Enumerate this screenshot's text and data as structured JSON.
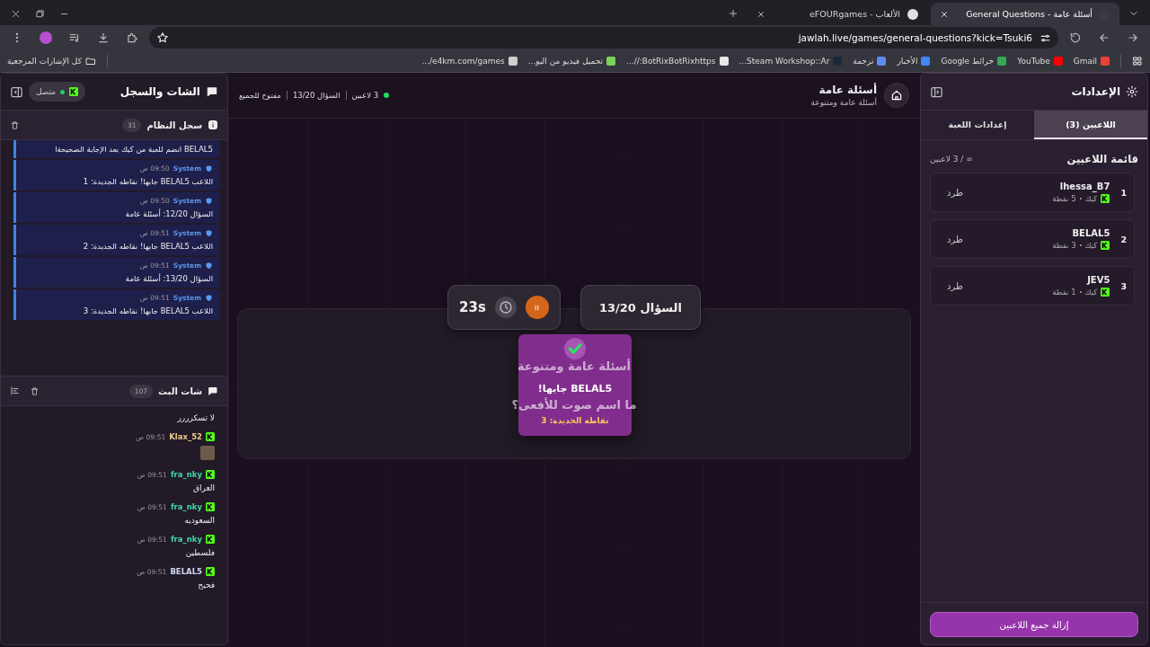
{
  "browser": {
    "tabs": [
      {
        "title": "أسئلة عامة - General Questions",
        "selected": true
      },
      {
        "title": "الألعاب - eFOURgames",
        "selected": false
      }
    ],
    "url": "jawlah.live/games/general-questions?kick=Tsuki6",
    "bookmarks": [
      {
        "label": "Gmail",
        "color": "#ea4335"
      },
      {
        "label": "YouTube",
        "color": "#ff0000"
      },
      {
        "label": "خرائط Google",
        "color": "#34a853"
      },
      {
        "label": "الأخبار",
        "color": "#4285f4"
      },
      {
        "label": "ترجمة",
        "color": "#5b8def"
      },
      {
        "label": "Steam Workshop::Ar...",
        "color": "#1b2838"
      },
      {
        "label": "BotRixBotRixhttps://...",
        "color": "#e8e8e8"
      },
      {
        "label": "تحميل فيديو من اليو...",
        "color": "#7bd15a"
      },
      {
        "label": "e4km.com/games/...",
        "color": "#cfcfcf"
      }
    ],
    "all_bookmarks": "كل الإشارات المرجعية"
  },
  "settings": {
    "title": "الإعدادات",
    "tabs": [
      {
        "label": "اللاعبين (3)",
        "selected": true
      },
      {
        "label": "إعدادات اللعبة",
        "selected": false
      }
    ],
    "list_title": "قائمة اللاعبين",
    "capacity": "∞ / 3 لاعبين",
    "players": [
      {
        "rank": "1",
        "name": "lhessa_B7",
        "platform": "كيك",
        "points": "5 نقطة",
        "kick": "طرد"
      },
      {
        "rank": "2",
        "name": "BELAL5",
        "platform": "كيك",
        "points": "3 نقطة",
        "kick": "طرد"
      },
      {
        "rank": "3",
        "name": "JEV5",
        "platform": "كيك",
        "points": "1 نقطة",
        "kick": "طرد"
      }
    ],
    "remove_all": "إزالة جميع اللاعبين"
  },
  "game": {
    "title": "أسئلة عامة",
    "subtitle": "أسئلة عامة ومتنوعة",
    "players_online": "3 لاعبين",
    "question_stat": "السؤال 13/20",
    "mode": "مفتوح للجميع",
    "question_pill": "السؤال 13/20",
    "timer": "23s",
    "category": "أسئلة عامة ومتنوعة",
    "question": "ما اسم صوت للأفعى؟",
    "popup": {
      "title": "BELAL5 جابها!",
      "points": "نقاطه الجديدة: 3"
    }
  },
  "chat_panel": {
    "title": "الشات والسجل",
    "status": "متصل",
    "system_log": {
      "title": "سجل النظام",
      "count": "31",
      "entries": [
        {
          "text": "BELAL5 انضم للعبة من كيك بعد الإجابة الصحيحةا"
        },
        {
          "sender": "System",
          "time": "09:50 ص",
          "text": "اللاعب BELAL5 جابها! نقاطه الجديدة: 1"
        },
        {
          "sender": "System",
          "time": "09:50 ص",
          "text": "السؤال 12/20: أسئلة عامة"
        },
        {
          "sender": "System",
          "time": "09:51 ص",
          "text": "اللاعب BELAL5 جابها! نقاطه الجديدة: 2"
        },
        {
          "sender": "System",
          "time": "09:51 ص",
          "text": "السؤال 13/20: أسئلة عامة"
        },
        {
          "sender": "System",
          "time": "09:51 ص",
          "text": "اللاعب BELAL5 جابها! نقاطه الجديدة: 3"
        }
      ]
    },
    "stream_chat": {
      "title": "شات البث",
      "count": "107",
      "messages": [
        {
          "kind": "text",
          "text": "لا تسكرررر"
        },
        {
          "kind": "image",
          "user": "Klax_52",
          "color": "#e9c98a",
          "time": "09:51 ص"
        },
        {
          "kind": "text",
          "user": "fra_nky",
          "color": "#3fd9a6",
          "time": "09:51 ص",
          "text": "العراق"
        },
        {
          "kind": "text",
          "user": "fra_nky",
          "color": "#3fd9a6",
          "time": "09:51 ص",
          "text": "السعوديه"
        },
        {
          "kind": "text",
          "user": "fra_nky",
          "color": "#3fd9a6",
          "time": "09:51 ص",
          "text": "فلسطين"
        },
        {
          "kind": "text",
          "user": "BELAL5",
          "color": "#cdd6f2",
          "time": "09:51 ص",
          "text": "فحيح"
        }
      ]
    }
  }
}
